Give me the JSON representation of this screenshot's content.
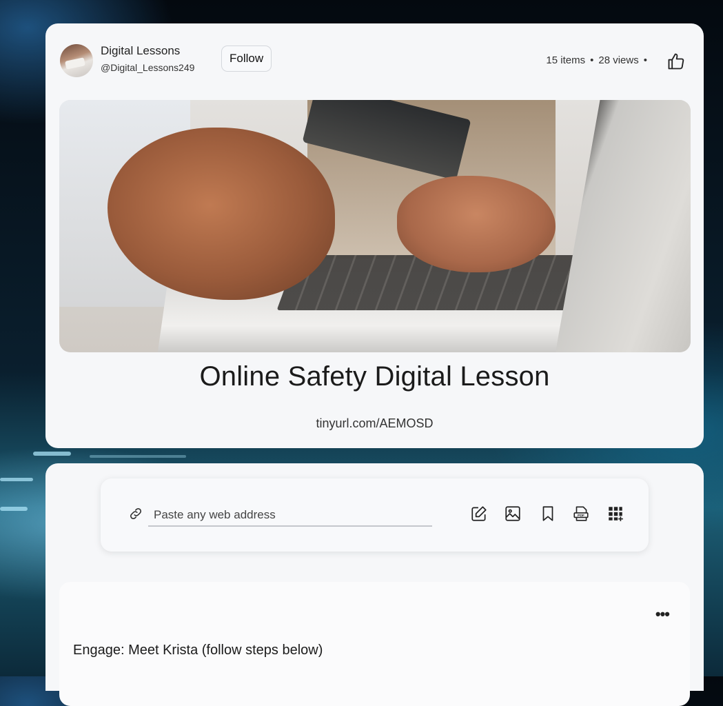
{
  "channel": {
    "name": "Digital Lessons",
    "handle": "@Digital_Lessons249",
    "follow_label": "Follow"
  },
  "stats": {
    "items": "15 items",
    "separator": "•",
    "views": "28 views",
    "like_icon": "thumbs-up-icon"
  },
  "lesson": {
    "title": "Online Safety Digital Lesson",
    "url": "tinyurl.com/AEMOSD",
    "hero_image": "hands holding credit card typing on laptop"
  },
  "composer": {
    "placeholder": "Paste any web address",
    "link_icon": "link-icon",
    "tools": [
      "edit-icon",
      "image-icon",
      "bookmark-icon",
      "pdf-icon",
      "qr-code-icon"
    ]
  },
  "post": {
    "title": "Engage: Meet Krista (follow steps below)",
    "more_label": "•••"
  },
  "colors": {
    "card_bg": "#f6f7f9",
    "text": "#1b1b1b",
    "background_dark": "#04090f",
    "background_teal": "#1c5d74"
  }
}
